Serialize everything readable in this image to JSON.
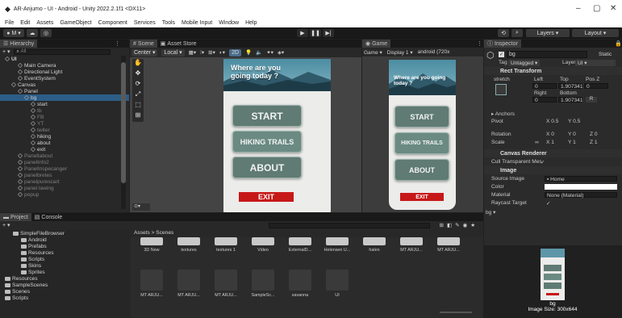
{
  "window": {
    "title": "AR-Anjumo - UI - Android - Unity 2022.2.1f1 <DX11>",
    "min": "–",
    "max": "▢",
    "close": "✕"
  },
  "menu": [
    "File",
    "Edit",
    "Assets",
    "GameObject",
    "Component",
    "Services",
    "Tools",
    "Mobile Input",
    "Window",
    "Help"
  ],
  "toolbar": {
    "account": "M ▾",
    "layers": "Layers",
    "layout": "Layout"
  },
  "hierarchy": {
    "tab": "Hierarchy",
    "search": "All",
    "items": [
      {
        "label": "UI",
        "depth": 0,
        "bold": true,
        "sel": false,
        "dim": false
      },
      {
        "label": "Main Camera",
        "depth": 2,
        "sel": false,
        "dim": false
      },
      {
        "label": "Directional Light",
        "depth": 2,
        "sel": false,
        "dim": false
      },
      {
        "label": "EventSystem",
        "depth": 2,
        "sel": false,
        "dim": false
      },
      {
        "label": "Canvas",
        "depth": 1,
        "sel": false,
        "dim": false
      },
      {
        "label": "Panel",
        "depth": 2,
        "sel": false,
        "dim": false
      },
      {
        "label": "bg",
        "depth": 3,
        "sel": true,
        "dim": false
      },
      {
        "label": "start",
        "depth": 4,
        "sel": false,
        "dim": false
      },
      {
        "label": "tb",
        "depth": 4,
        "sel": false,
        "dim": true
      },
      {
        "label": "FB",
        "depth": 4,
        "sel": false,
        "dim": true
      },
      {
        "label": "YT",
        "depth": 4,
        "sel": false,
        "dim": true
      },
      {
        "label": "twiter",
        "depth": 4,
        "sel": false,
        "dim": true
      },
      {
        "label": "hiking",
        "depth": 4,
        "sel": false,
        "dim": false
      },
      {
        "label": "about",
        "depth": 4,
        "sel": false,
        "dim": false
      },
      {
        "label": "exit",
        "depth": 4,
        "sel": false,
        "dim": false
      },
      {
        "label": "Paneltabout",
        "depth": 2,
        "sel": false,
        "dim": true
      },
      {
        "label": "panelInfo2",
        "depth": 2,
        "sel": false,
        "dim": true
      },
      {
        "label": "PanelInspecanger",
        "depth": 2,
        "sel": false,
        "dim": true
      },
      {
        "label": "panelbretes",
        "depth": 2,
        "sel": false,
        "dim": true
      },
      {
        "label": "panelpurescart",
        "depth": 2,
        "sel": false,
        "dim": true
      },
      {
        "label": "panel lawing",
        "depth": 2,
        "sel": false,
        "dim": true
      },
      {
        "label": "popup",
        "depth": 2,
        "sel": false,
        "dim": true
      }
    ]
  },
  "scene": {
    "tabs": [
      "Scene",
      "Asset Store"
    ],
    "pivot": "Center ▾",
    "space": "Local ▾",
    "mode2d": "2D"
  },
  "game": {
    "tab": "Game",
    "display_mode": "Game",
    "display": "Display 1",
    "resolution": "android (720x"
  },
  "phone": {
    "heading": "Where are you going today ?",
    "start": "START",
    "hiking": "HIKING TRAILS",
    "about": "ABOUT",
    "exit": "EXIT"
  },
  "inspector": {
    "tab": "Inspector",
    "name": "bg",
    "static": "Static",
    "tag_label": "Tag",
    "tag": "Untagged",
    "layer_label": "Layer",
    "layer": "UI",
    "rect_title": "Rect Transform",
    "stretch": "stretch",
    "left_label": "Left",
    "left": "0",
    "top_label": "Top",
    "top": "1.907341",
    "posz_label": "Pos Z",
    "posz": "0",
    "right_label": "Right",
    "right": "0",
    "bottom_label": "Bottom",
    "bottom": "1.907341",
    "anchors": "Anchors",
    "pivot_label": "Pivot",
    "pivot_x": "0.5",
    "pivot_y": "0.5",
    "rotation_label": "Rotation",
    "rot_x": "0",
    "rot_y": "0",
    "rot_z": "0",
    "scale_label": "Scale",
    "scale_x": "1",
    "scale_y": "1",
    "scale_z": "1",
    "canvas_renderer": "Canvas Renderer",
    "cull": "Cull Transparent Mes",
    "image_title": "Image",
    "source_label": "Source Image",
    "source": "Home",
    "color_label": "Color",
    "material_label": "Material",
    "material": "None (Material)",
    "raycast_label": "Raycast Target",
    "preview_label": "bg ▾",
    "preview_caption": "bg\nImage Size: 300x644"
  },
  "project": {
    "tabs": [
      "Project",
      "Console"
    ],
    "tree": [
      {
        "label": "SimpleFileBrowser",
        "depth": 1
      },
      {
        "label": "Android",
        "depth": 2
      },
      {
        "label": "Prefabs",
        "depth": 2
      },
      {
        "label": "Resources",
        "depth": 2
      },
      {
        "label": "Scripts",
        "depth": 2
      },
      {
        "label": "Skins",
        "depth": 2
      },
      {
        "label": "Sprites",
        "depth": 2
      },
      {
        "label": "Resources",
        "depth": 0
      },
      {
        "label": "SampleScenes",
        "depth": 0
      },
      {
        "label": "Scenes",
        "depth": 0
      },
      {
        "label": "Scripts",
        "depth": 0
      }
    ],
    "breadcrumb": "Assets > Scenes",
    "row1": [
      "3D New",
      "textures",
      "textures 1",
      "Video",
      "ExternalD...",
      "Helensen U...",
      "halen",
      "MT ARJU...",
      "MT ARJU..."
    ],
    "row2": [
      "MT ARJU...",
      "MT ARJU...",
      "MT ARJU...",
      "SampleSc...",
      "savanna",
      "UI"
    ]
  },
  "colors": {
    "accent": "#2c5d87",
    "phone_button": "#5f7b73",
    "exit": "#c71818"
  }
}
